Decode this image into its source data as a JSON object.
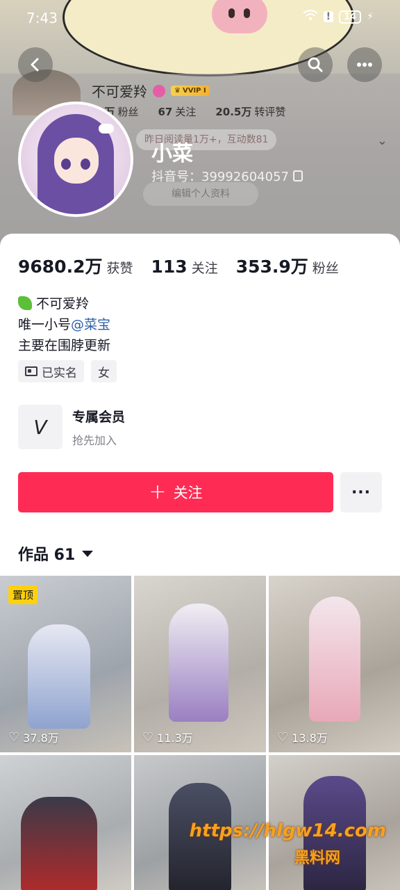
{
  "status_bar": {
    "time": "7:43",
    "battery": "14"
  },
  "banner": {
    "ghost_name": "不可爱羚",
    "vip_label": "VVIP I",
    "ghost_stats": [
      {
        "value": "8万",
        "label": "粉丝"
      },
      {
        "value": "67",
        "label": "关注"
      },
      {
        "value": "20.5万",
        "label": "转评赞"
      }
    ],
    "ghost_tip": "昨日阅读量1万+，互动数81",
    "ghost_edit": "编辑个人资料"
  },
  "profile": {
    "name": "小菜",
    "douyin_id": "抖音号：39992604057"
  },
  "stats": [
    {
      "value": "9680.2万",
      "label": "获赞"
    },
    {
      "value": "113",
      "label": "关注"
    },
    {
      "value": "353.9万",
      "label": "粉丝"
    }
  ],
  "bio": {
    "line1": "不可爱羚",
    "line2_prefix": "唯一小号",
    "line2_mention": "@菜宝",
    "line3": "主要在围脖更新"
  },
  "tags": {
    "verified": "已实名",
    "gender": "女"
  },
  "member": {
    "title": "专属会员",
    "subtitle": "抢先加入"
  },
  "actions": {
    "follow": "关注",
    "more": "···"
  },
  "works": {
    "label": "作品 61"
  },
  "grid": [
    {
      "likes": "37.8万",
      "pinned": "置顶"
    },
    {
      "likes": "11.3万"
    },
    {
      "likes": "13.8万"
    },
    {},
    {},
    {}
  ],
  "watermark": {
    "url": "https://hlgw14.com",
    "name": "黑料网"
  },
  "colors": {
    "accent": "#fe2c55",
    "pin": "#fdd10f",
    "mention": "#2a5fa8"
  },
  "icons": [
    "back-icon",
    "search-icon",
    "more-icon",
    "copy-icon",
    "id-card-icon",
    "member-v-icon",
    "plus-icon",
    "caret-down-icon",
    "heart-icon"
  ]
}
